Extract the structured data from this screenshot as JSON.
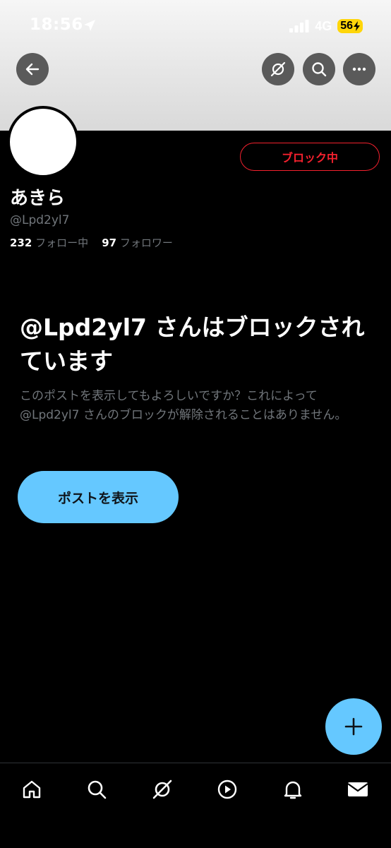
{
  "status_bar": {
    "time": "18:56",
    "network": "4G",
    "battery": "56"
  },
  "header": {
    "back_icon": "arrow-left-icon",
    "grok_icon": "grok-icon",
    "search_icon": "search-icon",
    "more_icon": "more-horizontal-icon"
  },
  "profile": {
    "block_button_label": "ブロック中",
    "display_name": "あきら",
    "handle": "@Lpd2yl7",
    "following_count": "232",
    "following_label": "フォロー中",
    "followers_count": "97",
    "followers_label": "フォロワー"
  },
  "blocked_notice": {
    "title": "@Lpd2yl7 さんはブロックされています",
    "description": "このポストを表示してもよろしいですか？これによって@Lpd2yl7 さんのブロックが解除されることはありません。",
    "view_posts_label": "ポストを表示"
  },
  "colors": {
    "accent": "#65c8ff",
    "danger": "#f4212e",
    "muted": "#71767b",
    "background": "#000000"
  },
  "tab_bar": {
    "items": [
      {
        "name": "home",
        "icon": "home-icon"
      },
      {
        "name": "search",
        "icon": "search-icon"
      },
      {
        "name": "grok",
        "icon": "grok-icon"
      },
      {
        "name": "video",
        "icon": "play-icon"
      },
      {
        "name": "notifications",
        "icon": "bell-icon"
      },
      {
        "name": "messages",
        "icon": "mail-icon"
      }
    ]
  },
  "fab": {
    "icon": "plus-icon"
  }
}
